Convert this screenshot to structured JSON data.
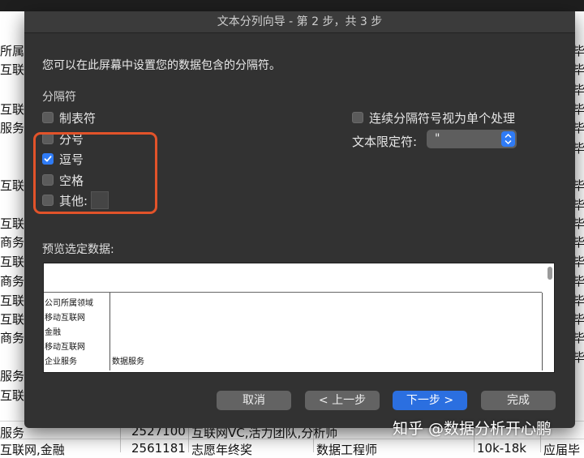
{
  "background_sheet": {
    "left_fragments": [
      "所属",
      "互联",
      "互联",
      "服务",
      "互联",
      "互联",
      "商务",
      "互联",
      "商务",
      "互联",
      "互联",
      "商务",
      "服务",
      "互联",
      "服务",
      "互联网"
    ],
    "right_fragments": [
      "毕",
      "毕",
      "毕",
      "毕",
      "毕",
      "毕",
      "毕",
      "毕",
      "毕",
      "毕",
      "毕",
      "毕",
      "毕",
      "毕",
      "毕",
      "毕"
    ],
    "bottom_rows": [
      {
        "cells": [
          "服务",
          "2527100",
          "互联网VC,活力团队,分析师",
          "",
          ""
        ]
      },
      {
        "cells": [
          "互联网,金融",
          "2561181",
          "志愿年终奖",
          "数据工程师",
          "10k-18k",
          "应届毕"
        ]
      }
    ]
  },
  "dialog": {
    "title": "文本分列向导 - 第 2 步，共 3 步",
    "instruction": "您可以在此屏幕中设置您的数据包含的分隔符。",
    "separator_heading": "分隔符",
    "delimiters": [
      {
        "label": "制表符",
        "checked": false
      },
      {
        "label": "分号",
        "checked": false
      },
      {
        "label": "逗号",
        "checked": true
      },
      {
        "label": "空格",
        "checked": false
      },
      {
        "label": "其他:",
        "checked": false
      }
    ],
    "consecutive_label": "连续分隔符号视为单个处理",
    "consecutive_checked": false,
    "text_qualifier_label": "文本限定符:",
    "text_qualifier_value": "\"",
    "preview_label": "预览选定数据:",
    "preview_rows": [
      [
        "公司所属领域",
        ""
      ],
      [
        "移动互联网",
        ""
      ],
      [
        "金融",
        ""
      ],
      [
        "移动互联网",
        ""
      ],
      [
        "企业服务",
        "数据服务"
      ]
    ],
    "buttons": {
      "cancel": "取消",
      "back": "< 上一步",
      "next": "下一步 >",
      "finish": "完成"
    },
    "highlight_color": "#e2532a",
    "accent_color": "#2b6fe0"
  },
  "watermark": "知乎 @数据分析开心鹏"
}
